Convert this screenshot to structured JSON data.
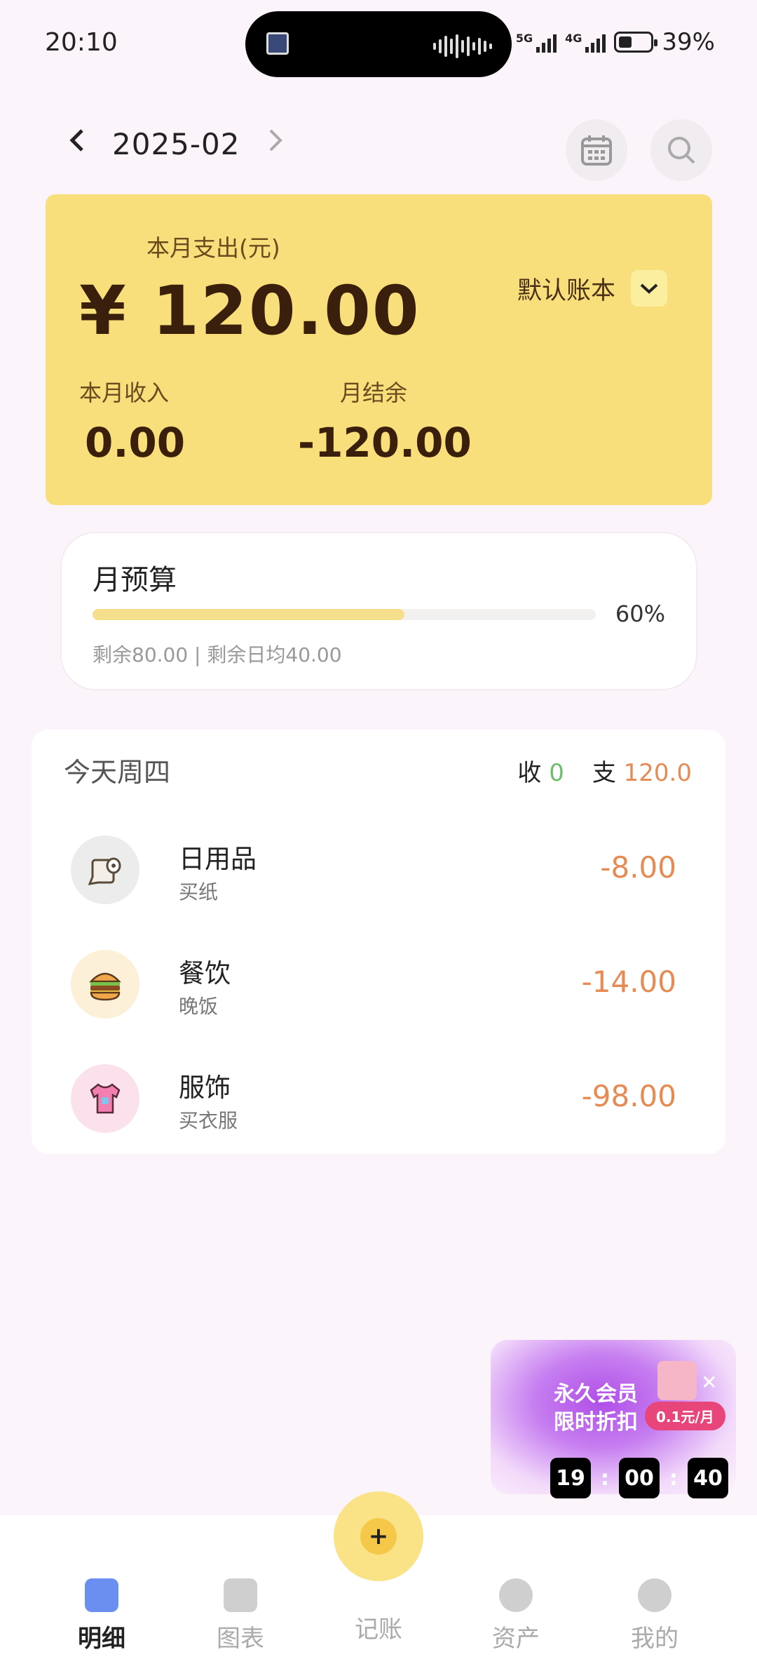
{
  "status_bar": {
    "time": "20:10",
    "signal1": "5G",
    "signal2": "4G",
    "battery": "39%"
  },
  "header": {
    "month": "2025-02"
  },
  "summary": {
    "expense_label": "本月支出(元)",
    "expense_amount": "¥ 120.00",
    "ledger": "默认账本",
    "income_label": "本月收入",
    "income_value": "0.00",
    "balance_label": "月结余",
    "balance_value": "-120.00"
  },
  "budget": {
    "title": "月预算",
    "percent_text": "60%",
    "progress": 0.62,
    "subtitle": "剩余80.00 | 剩余日均40.00"
  },
  "day": {
    "title": "今天周四",
    "income_label": "收",
    "income_value": "0",
    "expense_label": "支",
    "expense_value": "120.0",
    "items": [
      {
        "category": "日用品",
        "note": "买纸",
        "amount": "-8.00",
        "icon": "toilet-paper-icon",
        "bg": "#ececec"
      },
      {
        "category": "餐饮",
        "note": "晚饭",
        "amount": "-14.00",
        "icon": "burger-icon",
        "bg": "#fdf0d9"
      },
      {
        "category": "服饰",
        "note": "买衣服",
        "amount": "-98.00",
        "icon": "tshirt-icon",
        "bg": "#fbe1ec"
      }
    ]
  },
  "promo": {
    "line1": "永久会员",
    "line2": "限时折扣",
    "price": "0.1元/月",
    "countdown": [
      "19",
      "00",
      "40"
    ]
  },
  "tabs": [
    {
      "label": "明细",
      "active": true
    },
    {
      "label": "图表",
      "active": false
    },
    {
      "label": "记账",
      "active": false
    },
    {
      "label": "资产",
      "active": false
    },
    {
      "label": "我的",
      "active": false
    }
  ],
  "colors": {
    "accent_yellow": "#f9df7b",
    "expense_orange": "#e58b53",
    "income_green": "#6cc06a",
    "active_tab_blue": "#6a8ff0"
  }
}
